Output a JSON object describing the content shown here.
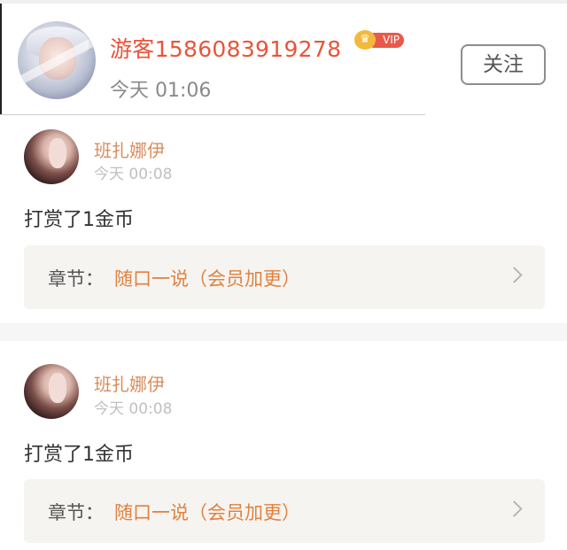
{
  "header": {
    "username": "游客1586083919278",
    "vip_label": "VIP",
    "vip_crown": "♛",
    "time": "今天 01:06",
    "follow_label": "关注"
  },
  "rewards": [
    {
      "name": "班扎娜伊",
      "time": "今天 00:08",
      "text": "打赏了1金币",
      "chapter_label": "章节：",
      "chapter_title": "随口一说（会员加更）"
    },
    {
      "name": "班扎娜伊",
      "time": "今天 00:08",
      "text": "打赏了1金币",
      "chapter_label": "章节：",
      "chapter_title": "随口一说（会员加更）"
    }
  ],
  "colors": {
    "username": "#e8553a",
    "vip": "#e9594a",
    "crown": "#f3b93a",
    "reward_name": "#d98c5c",
    "chapter_title": "#e0823f"
  },
  "icons": [
    "crown-icon",
    "chevron-right-icon"
  ]
}
